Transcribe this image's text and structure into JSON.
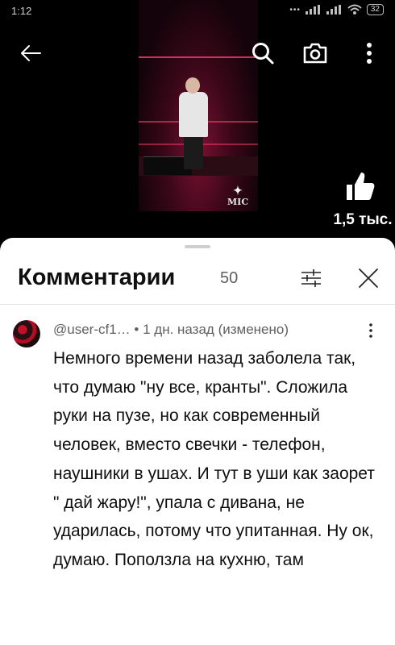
{
  "status_bar": {
    "time": "1:12",
    "battery": "32"
  },
  "video": {
    "watermark": "MIC"
  },
  "toolbar": {
    "back_icon": "arrow-left-icon",
    "search_icon": "search-icon",
    "camera_icon": "camera-icon",
    "more_icon": "more-vertical-icon"
  },
  "like": {
    "count": "1,5 тыс."
  },
  "comments_panel": {
    "title": "Комментарии",
    "count": "50",
    "filter_icon": "sort-filter-icon",
    "close_icon": "close-icon"
  },
  "comment": {
    "author": "@user-cf1…",
    "separator": "•",
    "time": "1 дн. назад (изменено)",
    "text": "Немного времени назад заболела так, что думаю \"ну все, кранты\". Сложила руки на пузе, но как современный человек, вместо свечки - телефон, наушники в ушах. И тут в уши как заорет \" дай жару!\", упала с дивана, не ударилась, потому что упитанная. Ну ок, думаю. Поползла на кухню, там"
  },
  "colors": {
    "sheet_bg": "#ffffff",
    "text_primary": "#0f0f0f",
    "text_secondary": "#606060",
    "background": "#000000"
  }
}
